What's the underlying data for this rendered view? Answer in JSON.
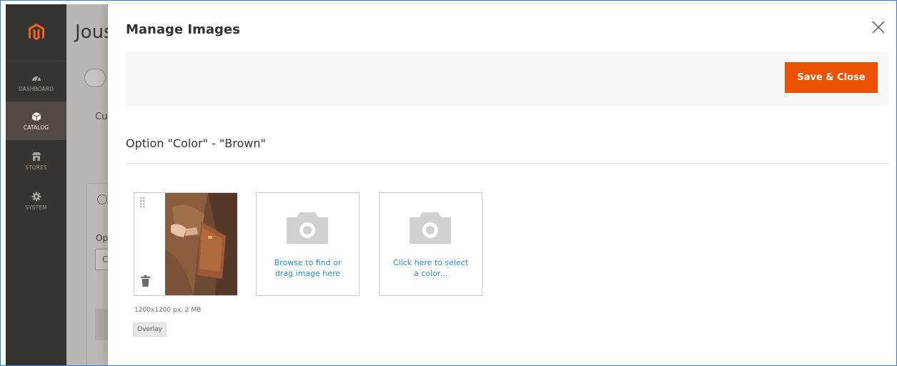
{
  "sidebar": {
    "items": [
      {
        "label": "DASHBOARD",
        "icon": "dashboard-icon",
        "active": false
      },
      {
        "label": "CATALOG",
        "icon": "catalog-icon",
        "active": true
      },
      {
        "label": "STORES",
        "icon": "stores-icon",
        "active": false
      },
      {
        "label": "SYSTEM",
        "icon": "gear-icon",
        "active": false
      }
    ]
  },
  "background_page": {
    "title_partial": "Jous",
    "cust_partial": "Cu",
    "option_label_partial": "Op",
    "input_partial": "C"
  },
  "modal": {
    "title": "Manage Images",
    "save_label": "Save & Close",
    "option_title": "Option \"Color\" - \"Brown\"",
    "upload_tile_text": "Browse to find or drag image here",
    "color_tile_text": "Click here to select a color...",
    "image_info": "1200x1200 px, 2 MB",
    "overlay_label": "Overlay"
  },
  "colors": {
    "accent": "#eb5202",
    "link": "#2a8fd6",
    "sidebar_bg": "#373330"
  }
}
